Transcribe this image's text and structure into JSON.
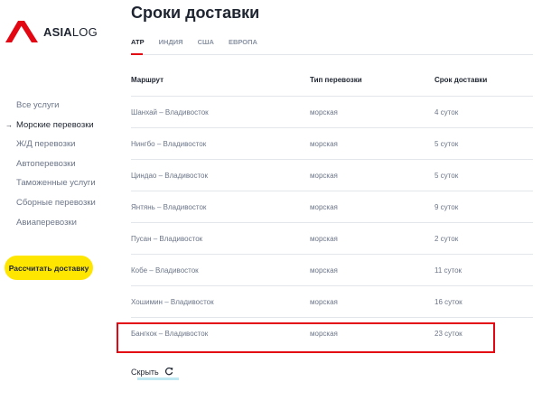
{
  "logo": {
    "text_bold": "ASIA",
    "text_light": "LOG",
    "color": "#e30613"
  },
  "sidebar": {
    "items": [
      {
        "label": "Все услуги",
        "active": false
      },
      {
        "label": "Морские перевозки",
        "active": true
      },
      {
        "label": "Ж/Д перевозки",
        "active": false
      },
      {
        "label": "Автоперевозки",
        "active": false
      },
      {
        "label": "Таможенные услуги",
        "active": false
      },
      {
        "label": "Сборные перевозки",
        "active": false
      },
      {
        "label": "Авиаперевозки",
        "active": false
      }
    ],
    "active_arrow": "→",
    "cta_label": "Рассчитать доставку",
    "cta_color": "#ffe600"
  },
  "main": {
    "title": "Сроки доставки",
    "tabs": [
      {
        "label": "АТР",
        "active": true
      },
      {
        "label": "ИНДИЯ",
        "active": false
      },
      {
        "label": "США",
        "active": false
      },
      {
        "label": "ЕВРОПА",
        "active": false
      }
    ],
    "accent_color": "#e30613",
    "table": {
      "headers": [
        "Маршрут",
        "Тип перевозки",
        "Срок доставки"
      ],
      "rows": [
        [
          "Шанхай – Владивосток",
          "морская",
          "4 суток"
        ],
        [
          "Нингбо – Владивосток",
          "морская",
          "5 суток"
        ],
        [
          "Циндао – Владивосток",
          "морская",
          "5 суток"
        ],
        [
          "Янтянь – Владивосток",
          "морская",
          "9 суток"
        ],
        [
          "Пусан – Владивосток",
          "морская",
          "2 суток"
        ],
        [
          "Кобе – Владивосток",
          "морская",
          "11 суток"
        ],
        [
          "Хошимин – Владивосток",
          "морская",
          "16 суток"
        ],
        [
          "Бангкок – Владивосток",
          "морская",
          "23 суток"
        ]
      ]
    },
    "hide_label": "Скрыть",
    "hide_icon": "refresh-icon"
  }
}
